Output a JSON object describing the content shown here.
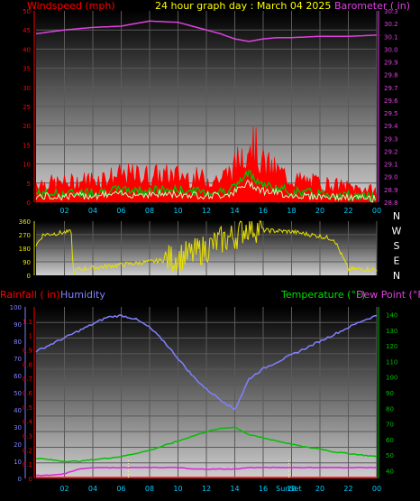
{
  "header": {
    "title": "24 hour graph day : March 04 2025",
    "left_label": "Windspeed (mph)",
    "right_label": "Barometer ( in)"
  },
  "direction_labels": [
    "N",
    "W",
    "S",
    "E",
    "N"
  ],
  "middle_labels": {
    "rain": "Rainfall ( in)",
    "humidity": "Humidity",
    "temperature": "Temperature (°F)",
    "dewpoint": "Dew Point (°F)"
  },
  "x_ticks": [
    "02",
    "04",
    "06",
    "08",
    "10",
    "12",
    "14",
    "16",
    "18",
    "20",
    "22",
    "00"
  ],
  "sun_labels": {
    "sunrise": "Sunrise",
    "sunset": "SunSet"
  },
  "colors": {
    "wind": "#ff0000",
    "barometer": "#e040e0",
    "gust_avg": "#00c000",
    "wind_avg": "#c0ffc0",
    "direction": "#e8e000",
    "humidity": "#8080ff",
    "temperature": "#00c000",
    "dewpoint": "#e020e0",
    "rain": "#ff2020"
  },
  "chart_data": [
    {
      "type": "line",
      "name": "wind-barometer",
      "x": [
        0,
        2,
        4,
        6,
        8,
        10,
        12,
        13,
        14,
        15,
        16,
        17,
        18,
        20,
        22,
        24
      ],
      "series": [
        {
          "name": "Windspeed",
          "values": [
            5,
            5,
            6,
            7,
            7,
            7,
            6,
            6,
            9,
            17,
            10,
            8,
            6,
            5,
            4,
            3
          ]
        },
        {
          "name": "Barometer",
          "values": [
            30.12,
            30.15,
            30.17,
            30.18,
            30.22,
            30.21,
            30.15,
            30.12,
            30.08,
            30.06,
            30.08,
            30.09,
            30.09,
            30.1,
            30.1,
            30.11
          ]
        }
      ],
      "y_left": {
        "label": "Windspeed (mph)",
        "ylim": [
          0,
          50
        ],
        "ticks": [
          0,
          5,
          10,
          15,
          20,
          25,
          30,
          35,
          40,
          45,
          50
        ]
      },
      "y_right": {
        "label": "Barometer ( in)",
        "ylim": [
          28.8,
          30.3
        ],
        "ticks": [
          28.8,
          28.9,
          29.0,
          29.1,
          29.2,
          29.3,
          29.4,
          29.5,
          29.6,
          29.7,
          29.8,
          29.9,
          30.0,
          30.1,
          30.2,
          30.3
        ]
      }
    },
    {
      "type": "line",
      "name": "wind-direction",
      "x": [
        0,
        0.5,
        2.5,
        2.6,
        3,
        5,
        7,
        9,
        11,
        12,
        13,
        14,
        15,
        16,
        18,
        20,
        21,
        22,
        23,
        24
      ],
      "series": [
        {
          "name": "Direction",
          "values": [
            200,
            270,
            290,
            20,
            40,
            60,
            80,
            100,
            140,
            180,
            230,
            260,
            330,
            300,
            290,
            260,
            240,
            40,
            40,
            40
          ]
        }
      ],
      "y_left": {
        "ylim": [
          0,
          360
        ],
        "ticks": [
          0,
          90,
          180,
          270,
          360
        ]
      }
    },
    {
      "type": "line",
      "name": "temperature-humidity",
      "x": [
        0,
        1,
        2,
        3,
        4,
        5,
        6,
        7,
        8,
        9,
        10,
        11,
        12,
        13,
        14,
        15,
        16,
        17,
        18,
        19,
        20,
        21,
        22,
        23,
        24
      ],
      "series": [
        {
          "name": "Humidity",
          "values": [
            74,
            78,
            82,
            86,
            90,
            94,
            95,
            93,
            88,
            80,
            70,
            60,
            52,
            46,
            40,
            58,
            64,
            68,
            72,
            76,
            80,
            84,
            88,
            92,
            95
          ]
        },
        {
          "name": "Temperature",
          "values": [
            48,
            47,
            46,
            46,
            47,
            48,
            49,
            51,
            53,
            56,
            59,
            62,
            65,
            67,
            68,
            63,
            61,
            59,
            57,
            55,
            54,
            52,
            51,
            50,
            49
          ]
        },
        {
          "name": "Dew Point",
          "values": [
            37,
            37,
            38,
            41,
            42,
            42,
            42,
            42,
            42,
            42,
            42,
            41,
            41,
            41,
            41,
            42,
            42,
            42,
            42,
            42,
            42,
            42,
            42,
            42,
            42
          ]
        },
        {
          "name": "Rainfall",
          "values": [
            0,
            0,
            0,
            0,
            0,
            0,
            0,
            0,
            0,
            0,
            0,
            0,
            0,
            0,
            0,
            0,
            0,
            0,
            0,
            0,
            0,
            0,
            0,
            0,
            0
          ]
        }
      ],
      "y_left": {
        "label": "Rainfall ( in)",
        "ylim": [
          0,
          1.2
        ],
        "ticks": [
          0,
          0.1,
          0.2,
          0.3,
          0.4,
          0.5,
          0.6,
          0.7,
          0.8,
          0.9,
          1,
          1.1
        ]
      },
      "y_left_outer": {
        "label": "Humidity",
        "ylim": [
          0,
          100
        ],
        "ticks": [
          0,
          10,
          20,
          30,
          40,
          50,
          60,
          70,
          80,
          90,
          100
        ]
      },
      "y_right": {
        "label": "Temperature (°F)",
        "ylim": [
          35,
          145
        ],
        "ticks": [
          40,
          50,
          60,
          70,
          80,
          90,
          100,
          110,
          120,
          130,
          140
        ]
      }
    }
  ]
}
